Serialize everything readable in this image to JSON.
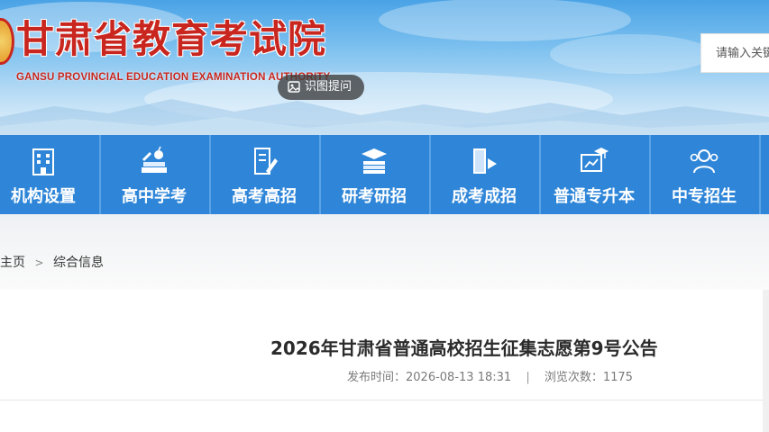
{
  "header": {
    "title": "甘肃省教育考试院",
    "subtitle": "GANSU PROVINCIAL EDUCATION EXAMINATION AUTHORITY",
    "search_placeholder": "请输入关键字",
    "ocr_button_label": "识图提问"
  },
  "nav": {
    "items": [
      {
        "label": "机构设置",
        "icon": "building-icon"
      },
      {
        "label": "高中学考",
        "icon": "books-apple-icon"
      },
      {
        "label": "高考高招",
        "icon": "document-pen-icon"
      },
      {
        "label": "研考研招",
        "icon": "graduation-books-icon"
      },
      {
        "label": "成考成招",
        "icon": "book-flag-icon"
      },
      {
        "label": "普通专升本",
        "icon": "board-cap-icon"
      },
      {
        "label": "中专招生",
        "icon": "users-icon"
      }
    ]
  },
  "breadcrumb": {
    "home": "主页",
    "separator": ">",
    "current": "综合信息"
  },
  "article": {
    "title": "2026年甘肃省普通高校招生征集志愿第9号公告",
    "publish_label": "发布时间：",
    "publish_time": "2026-08-13 18:31",
    "meta_separator": "|",
    "views_label": "浏览次数：",
    "views": "1175"
  },
  "colors": {
    "brand_red": "#c8261e",
    "nav_blue": "#2f86d8"
  }
}
